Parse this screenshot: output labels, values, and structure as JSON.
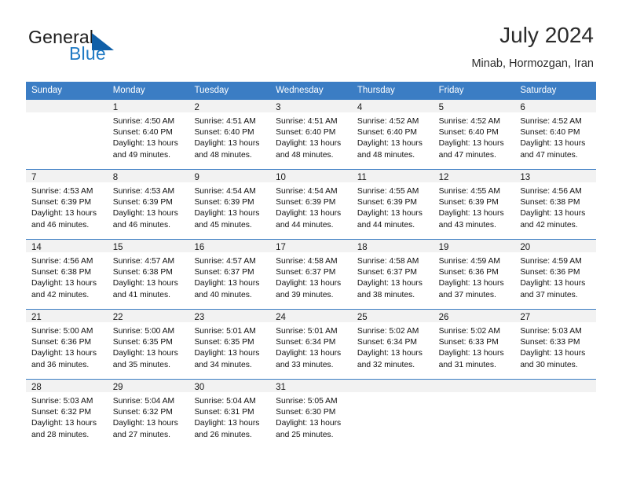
{
  "brand": {
    "name_part1": "General",
    "name_part2": "Blue",
    "triangle_color": "#1160a8",
    "blue_color": "#1f7ac4"
  },
  "header": {
    "title": "July 2024",
    "subtitle": "Minab, Hormozgan, Iran"
  },
  "theme": {
    "header_row_bg": "#3b7dc4",
    "daynum_band_bg": "#f2f2f2",
    "week_divider": "#3b7dc4"
  },
  "weekdays": [
    "Sunday",
    "Monday",
    "Tuesday",
    "Wednesday",
    "Thursday",
    "Friday",
    "Saturday"
  ],
  "weeks": [
    [
      {
        "day": "",
        "lines": []
      },
      {
        "day": "1",
        "lines": [
          "Sunrise: 4:50 AM",
          "Sunset: 6:40 PM",
          "Daylight: 13 hours",
          "and 49 minutes."
        ]
      },
      {
        "day": "2",
        "lines": [
          "Sunrise: 4:51 AM",
          "Sunset: 6:40 PM",
          "Daylight: 13 hours",
          "and 48 minutes."
        ]
      },
      {
        "day": "3",
        "lines": [
          "Sunrise: 4:51 AM",
          "Sunset: 6:40 PM",
          "Daylight: 13 hours",
          "and 48 minutes."
        ]
      },
      {
        "day": "4",
        "lines": [
          "Sunrise: 4:52 AM",
          "Sunset: 6:40 PM",
          "Daylight: 13 hours",
          "and 48 minutes."
        ]
      },
      {
        "day": "5",
        "lines": [
          "Sunrise: 4:52 AM",
          "Sunset: 6:40 PM",
          "Daylight: 13 hours",
          "and 47 minutes."
        ]
      },
      {
        "day": "6",
        "lines": [
          "Sunrise: 4:52 AM",
          "Sunset: 6:40 PM",
          "Daylight: 13 hours",
          "and 47 minutes."
        ]
      }
    ],
    [
      {
        "day": "7",
        "lines": [
          "Sunrise: 4:53 AM",
          "Sunset: 6:39 PM",
          "Daylight: 13 hours",
          "and 46 minutes."
        ]
      },
      {
        "day": "8",
        "lines": [
          "Sunrise: 4:53 AM",
          "Sunset: 6:39 PM",
          "Daylight: 13 hours",
          "and 46 minutes."
        ]
      },
      {
        "day": "9",
        "lines": [
          "Sunrise: 4:54 AM",
          "Sunset: 6:39 PM",
          "Daylight: 13 hours",
          "and 45 minutes."
        ]
      },
      {
        "day": "10",
        "lines": [
          "Sunrise: 4:54 AM",
          "Sunset: 6:39 PM",
          "Daylight: 13 hours",
          "and 44 minutes."
        ]
      },
      {
        "day": "11",
        "lines": [
          "Sunrise: 4:55 AM",
          "Sunset: 6:39 PM",
          "Daylight: 13 hours",
          "and 44 minutes."
        ]
      },
      {
        "day": "12",
        "lines": [
          "Sunrise: 4:55 AM",
          "Sunset: 6:39 PM",
          "Daylight: 13 hours",
          "and 43 minutes."
        ]
      },
      {
        "day": "13",
        "lines": [
          "Sunrise: 4:56 AM",
          "Sunset: 6:38 PM",
          "Daylight: 13 hours",
          "and 42 minutes."
        ]
      }
    ],
    [
      {
        "day": "14",
        "lines": [
          "Sunrise: 4:56 AM",
          "Sunset: 6:38 PM",
          "Daylight: 13 hours",
          "and 42 minutes."
        ]
      },
      {
        "day": "15",
        "lines": [
          "Sunrise: 4:57 AM",
          "Sunset: 6:38 PM",
          "Daylight: 13 hours",
          "and 41 minutes."
        ]
      },
      {
        "day": "16",
        "lines": [
          "Sunrise: 4:57 AM",
          "Sunset: 6:37 PM",
          "Daylight: 13 hours",
          "and 40 minutes."
        ]
      },
      {
        "day": "17",
        "lines": [
          "Sunrise: 4:58 AM",
          "Sunset: 6:37 PM",
          "Daylight: 13 hours",
          "and 39 minutes."
        ]
      },
      {
        "day": "18",
        "lines": [
          "Sunrise: 4:58 AM",
          "Sunset: 6:37 PM",
          "Daylight: 13 hours",
          "and 38 minutes."
        ]
      },
      {
        "day": "19",
        "lines": [
          "Sunrise: 4:59 AM",
          "Sunset: 6:36 PM",
          "Daylight: 13 hours",
          "and 37 minutes."
        ]
      },
      {
        "day": "20",
        "lines": [
          "Sunrise: 4:59 AM",
          "Sunset: 6:36 PM",
          "Daylight: 13 hours",
          "and 37 minutes."
        ]
      }
    ],
    [
      {
        "day": "21",
        "lines": [
          "Sunrise: 5:00 AM",
          "Sunset: 6:36 PM",
          "Daylight: 13 hours",
          "and 36 minutes."
        ]
      },
      {
        "day": "22",
        "lines": [
          "Sunrise: 5:00 AM",
          "Sunset: 6:35 PM",
          "Daylight: 13 hours",
          "and 35 minutes."
        ]
      },
      {
        "day": "23",
        "lines": [
          "Sunrise: 5:01 AM",
          "Sunset: 6:35 PM",
          "Daylight: 13 hours",
          "and 34 minutes."
        ]
      },
      {
        "day": "24",
        "lines": [
          "Sunrise: 5:01 AM",
          "Sunset: 6:34 PM",
          "Daylight: 13 hours",
          "and 33 minutes."
        ]
      },
      {
        "day": "25",
        "lines": [
          "Sunrise: 5:02 AM",
          "Sunset: 6:34 PM",
          "Daylight: 13 hours",
          "and 32 minutes."
        ]
      },
      {
        "day": "26",
        "lines": [
          "Sunrise: 5:02 AM",
          "Sunset: 6:33 PM",
          "Daylight: 13 hours",
          "and 31 minutes."
        ]
      },
      {
        "day": "27",
        "lines": [
          "Sunrise: 5:03 AM",
          "Sunset: 6:33 PM",
          "Daylight: 13 hours",
          "and 30 minutes."
        ]
      }
    ],
    [
      {
        "day": "28",
        "lines": [
          "Sunrise: 5:03 AM",
          "Sunset: 6:32 PM",
          "Daylight: 13 hours",
          "and 28 minutes."
        ]
      },
      {
        "day": "29",
        "lines": [
          "Sunrise: 5:04 AM",
          "Sunset: 6:32 PM",
          "Daylight: 13 hours",
          "and 27 minutes."
        ]
      },
      {
        "day": "30",
        "lines": [
          "Sunrise: 5:04 AM",
          "Sunset: 6:31 PM",
          "Daylight: 13 hours",
          "and 26 minutes."
        ]
      },
      {
        "day": "31",
        "lines": [
          "Sunrise: 5:05 AM",
          "Sunset: 6:30 PM",
          "Daylight: 13 hours",
          "and 25 minutes."
        ]
      },
      {
        "day": "",
        "lines": []
      },
      {
        "day": "",
        "lines": []
      },
      {
        "day": "",
        "lines": []
      }
    ]
  ]
}
